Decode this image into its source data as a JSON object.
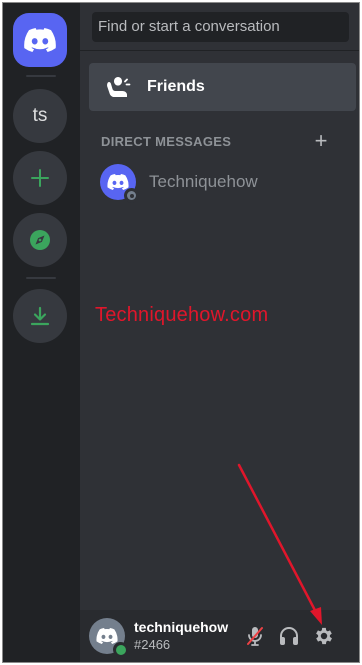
{
  "search": {
    "placeholder": "Find or start a conversation"
  },
  "servers": {
    "guild_initials": "ts"
  },
  "nav": {
    "friends_label": "Friends"
  },
  "direct_messages": {
    "header": "DIRECT MESSAGES",
    "add_symbol": "+",
    "items": [
      {
        "name": "Techniquehow"
      }
    ]
  },
  "watermark": "Techniquehow.com",
  "user": {
    "name": "techniquehow",
    "tag": "#2466"
  },
  "colors": {
    "brand": "#5865f2",
    "rail_bg": "#202225",
    "pane_bg": "#2f3136",
    "online": "#3ba55d",
    "accent_green": "#3ba55d",
    "mute_slash": "#ed4245",
    "annotation": "#e0162b"
  },
  "icons": {
    "home": "discord-logo-icon",
    "add_server": "plus-icon",
    "explore": "compass-icon",
    "download": "download-icon",
    "friends": "friends-wave-icon",
    "mic": "microphone-muted-icon",
    "headphones": "headphones-icon",
    "settings": "gear-icon"
  }
}
